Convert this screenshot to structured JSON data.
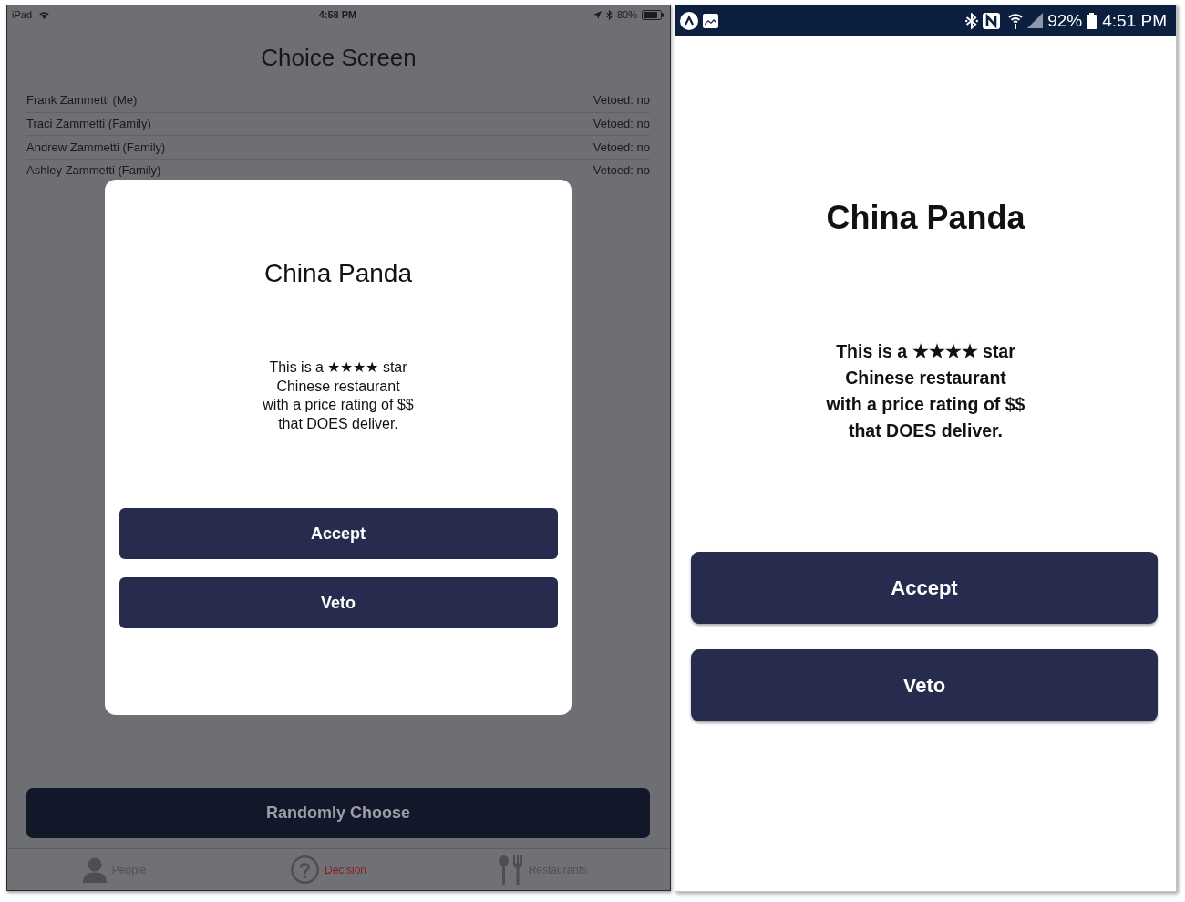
{
  "tablet": {
    "status_bar": {
      "device": "iPad",
      "time": "4:58 PM",
      "battery": "80%"
    },
    "title": "Choice Screen",
    "people": [
      {
        "name": "Frank Zammetti (Me)",
        "veto_status": "Vetoed: no"
      },
      {
        "name": "Traci Zammetti (Family)",
        "veto_status": "Vetoed: no"
      },
      {
        "name": "Andrew Zammetti (Family)",
        "veto_status": "Vetoed: no"
      },
      {
        "name": "Ashley Zammetti (Family)",
        "veto_status": "Vetoed: no"
      }
    ],
    "dialog": {
      "title": "China Panda",
      "description": "This is a ★★★★ star\nChinese restaurant\nwith a price rating of $$\nthat DOES deliver.",
      "buttons": [
        "Accept",
        "Veto"
      ]
    },
    "action_button": "Randomly Choose",
    "tabs": [
      {
        "label": "People",
        "selected": false
      },
      {
        "label": "Decision",
        "selected": true
      },
      {
        "label": "Restaurants",
        "selected": false
      }
    ]
  },
  "phone": {
    "status_bar": {
      "battery": "92%",
      "time": "4:51 PM"
    },
    "title": "China Panda",
    "description": "This is a ★★★★ star\nChinese restaurant\nwith a price rating of $$\nthat DOES deliver.",
    "buttons": [
      "Accept",
      "Veto"
    ]
  }
}
